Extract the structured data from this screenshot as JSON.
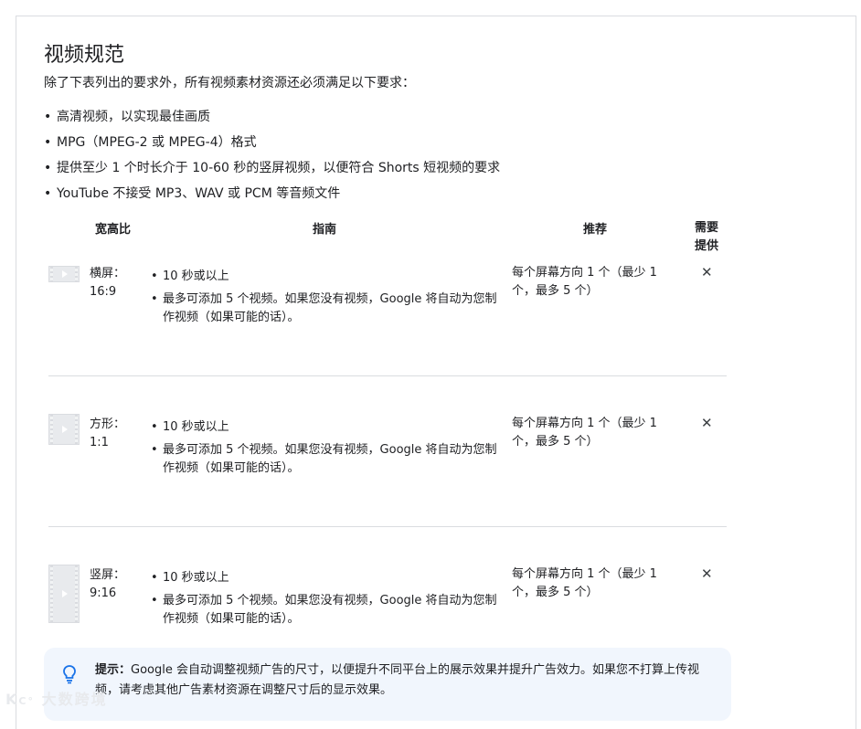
{
  "title": "视频规范",
  "intro": "除了下表列出的要求外，所有视频素材资源还必须满足以下要求：",
  "requirements": [
    "高清视频，以实现最佳画质",
    "MPG（MPEG-2 或 MPEG-4）格式",
    "提供至少 1 个时长介于 10-60 秒的竖屏视频，以便符合 Shorts 短视频的要求",
    "YouTube 不接受 MP3、WAV 或 PCM 等音频文件"
  ],
  "table": {
    "headers": {
      "ratio": "宽高比",
      "guide": "指南",
      "recommend": "推荐",
      "required": "需要\n提供"
    },
    "rows": [
      {
        "ratio": "横屏：\n16:9",
        "guide": [
          "10 秒或以上",
          "最多可添加 5 个视频。如果您没有视频，Google 将自动为您制作视频（如果可能的话）。"
        ],
        "recommend": "每个屏幕方向 1 个（最少 1 个，最多 5 个）",
        "required": "✕"
      },
      {
        "ratio": "方形：\n1:1",
        "guide": [
          "10 秒或以上",
          "最多可添加 5 个视频。如果您没有视频，Google 将自动为您制作视频（如果可能的话）。"
        ],
        "recommend": "每个屏幕方向 1 个（最少 1 个，最多 5 个）",
        "required": "✕"
      },
      {
        "ratio": "竖屏：\n9:16",
        "guide": [
          "10 秒或以上",
          "最多可添加 5 个视频。如果您没有视频，Google 将自动为您制作视频（如果可能的话）。"
        ],
        "recommend": "每个屏幕方向 1 个（最少 1 个，最多 5 个）",
        "required": "✕"
      }
    ]
  },
  "tip": {
    "label": "提示：",
    "text": "Google 会自动调整视频广告的尺寸，以便提升不同平台上的展示效果并提升广告效力。如果您不打算上传视频，请考虑其他广告素材资源在调整尺寸后的显示效果。",
    "icon": "lightbulb-icon",
    "icon_color": "#1a73e8"
  },
  "watermark": "大数跨境"
}
